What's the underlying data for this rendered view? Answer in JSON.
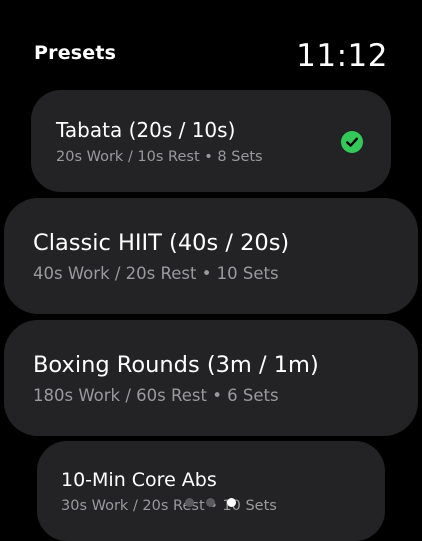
{
  "header": {
    "title": "Presets",
    "time": "11:12"
  },
  "presets": [
    {
      "name": "Tabata (20s / 10s)",
      "detail": "20s Work / 10s Rest • 8 Sets",
      "selected": true
    },
    {
      "name": "Classic HIIT (40s / 20s)",
      "detail": "40s Work / 20s Rest • 10 Sets",
      "selected": false
    },
    {
      "name": "Boxing Rounds (3m / 1m)",
      "detail": "180s Work / 60s Rest • 6 Sets",
      "selected": false
    },
    {
      "name": "10-Min Core Abs",
      "detail": "30s Work / 20s Rest • 10 Sets",
      "selected": false
    }
  ],
  "page_indicator": {
    "count": 3,
    "active_index": 2
  },
  "colors": {
    "background": "#000000",
    "card": "#232325",
    "secondary_text": "#9a9a9e",
    "selected_check": "#34c759"
  },
  "icons": {
    "selected": "checkmark-circle-icon"
  }
}
